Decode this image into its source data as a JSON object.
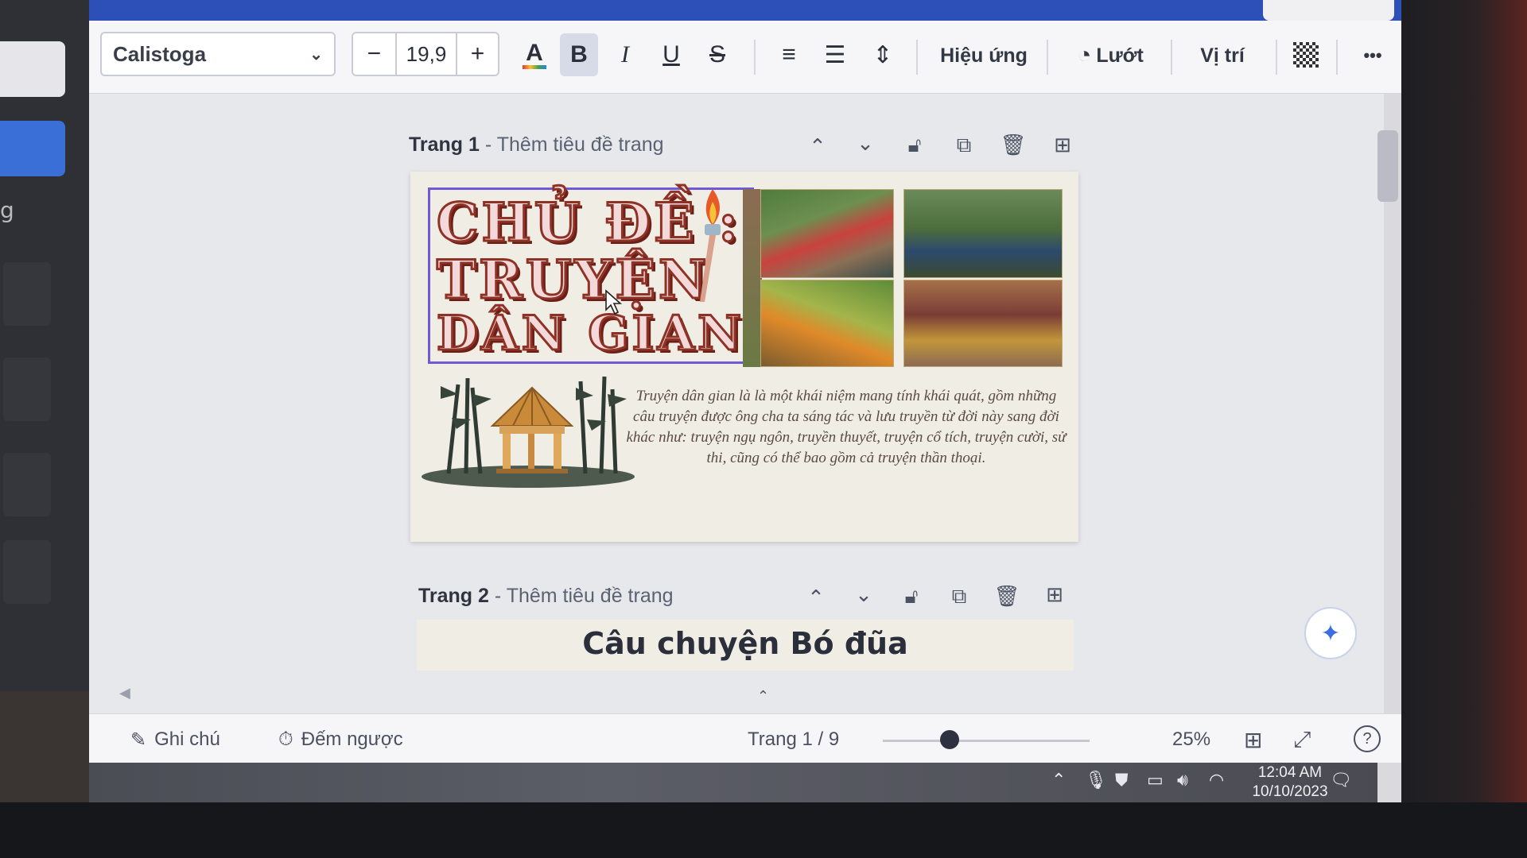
{
  "toolbar": {
    "font_name": "Calistoga",
    "font_size": "19,9",
    "minus": "−",
    "plus": "+",
    "color_label": "A",
    "bold_label": "B",
    "italic_label": "I",
    "underline_label": "U",
    "strike_label": "S",
    "effects_label": "Hiệu ứng",
    "animate_label": "Lướt",
    "position_label": "Vị trí",
    "more_label": "•••"
  },
  "pages": [
    {
      "number_label": "Trang 1",
      "title_placeholder": "- Thêm tiêu đề trang",
      "heading_lines": [
        "CHỦ ĐỀ :",
        "TRUYỆN",
        "DÂN GIAN"
      ],
      "description": "Truyện dân gian là là một khái niệm mang tính khái quát, gồm những câu truyện được ông cha ta sáng tác và lưu truyền từ đời này sang đời khác như: truyện ngụ ngôn, truyền thuyết, truyện cổ tích, truyện cười, sử thi, cũng có thể bao gồm cả truyện thần thoại."
    },
    {
      "number_label": "Trang 2",
      "title_placeholder": "- Thêm tiêu đề trang",
      "story_title": "Câu chuyện Bó đũa"
    }
  ],
  "footer": {
    "notes_label": "Ghi chú",
    "timer_label": "Đếm ngược",
    "page_indicator": "Trang 1 / 9",
    "zoom": "25%"
  },
  "taskbar": {
    "time": "12:04 AM",
    "date": "10/10/2023"
  },
  "colors": {
    "accent": "#3b6fd8",
    "selection": "#6f5ad6",
    "title_red": "#8e3226"
  }
}
